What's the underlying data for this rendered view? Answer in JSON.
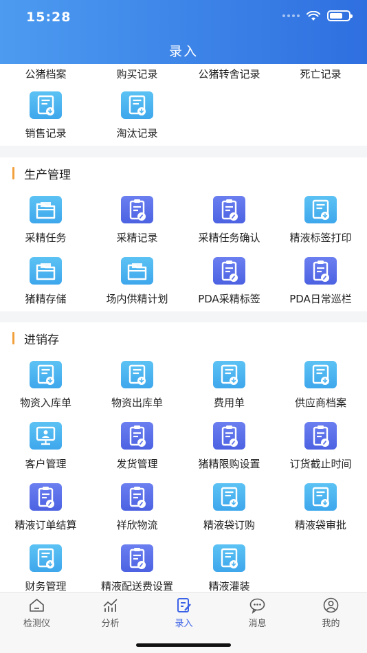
{
  "status": {
    "time": "15:28"
  },
  "header": {
    "title": "录入"
  },
  "top_section": {
    "labels_row": [
      "公猪档案",
      "购买记录",
      "公猪转舍记录",
      "死亡记录"
    ],
    "items": [
      {
        "label": "销售记录",
        "icon": "doc-download-icon",
        "tone": "light"
      },
      {
        "label": "淘汰记录",
        "icon": "doc-download-icon",
        "tone": "light"
      }
    ]
  },
  "production": {
    "title": "生产管理",
    "items": [
      {
        "label": "采精任务",
        "icon": "folder-icon",
        "tone": "light"
      },
      {
        "label": "采精记录",
        "icon": "clipboard-edit-icon",
        "tone": "dark"
      },
      {
        "label": "采精任务确认",
        "icon": "clipboard-edit-icon",
        "tone": "dark"
      },
      {
        "label": "精液标签打印",
        "icon": "doc-download-icon",
        "tone": "light"
      },
      {
        "label": "猪精存储",
        "icon": "folder-icon",
        "tone": "light"
      },
      {
        "label": "场内供精计划",
        "icon": "folder-icon",
        "tone": "light"
      },
      {
        "label": "PDA采精标签",
        "icon": "clipboard-edit-icon",
        "tone": "dark"
      },
      {
        "label": "PDA日常巡栏",
        "icon": "clipboard-edit-icon",
        "tone": "dark"
      }
    ]
  },
  "inventory": {
    "title": "进销存",
    "items": [
      {
        "label": "物资入库单",
        "icon": "doc-download-icon",
        "tone": "light"
      },
      {
        "label": "物资出库单",
        "icon": "doc-download-icon",
        "tone": "light"
      },
      {
        "label": "费用单",
        "icon": "doc-download-icon",
        "tone": "light"
      },
      {
        "label": "供应商档案",
        "icon": "doc-download-icon",
        "tone": "light"
      },
      {
        "label": "客户管理",
        "icon": "monitor-user-icon",
        "tone": "light"
      },
      {
        "label": "发货管理",
        "icon": "clipboard-edit-icon",
        "tone": "dark"
      },
      {
        "label": "猪精限购设置",
        "icon": "clipboard-edit-icon",
        "tone": "dark"
      },
      {
        "label": "订货截止时间",
        "icon": "clipboard-edit-icon",
        "tone": "dark"
      },
      {
        "label": "精液订单结算",
        "icon": "clipboard-edit-icon",
        "tone": "dark"
      },
      {
        "label": "祥欣物流",
        "icon": "clipboard-edit-icon",
        "tone": "dark"
      },
      {
        "label": "精液袋订购",
        "icon": "doc-download-icon",
        "tone": "light"
      },
      {
        "label": "精液袋审批",
        "icon": "doc-download-icon",
        "tone": "light"
      },
      {
        "label": "财务管理",
        "icon": "doc-download-icon",
        "tone": "light"
      },
      {
        "label": "精液配送费设置",
        "icon": "clipboard-edit-icon",
        "tone": "dark"
      },
      {
        "label": "精液灌装",
        "icon": "doc-download-icon",
        "tone": "light"
      }
    ]
  },
  "tabbar": {
    "tabs": [
      {
        "label": "检测仪",
        "icon": "home-icon"
      },
      {
        "label": "分析",
        "icon": "chart-icon"
      },
      {
        "label": "录入",
        "icon": "edit-icon",
        "active": true
      },
      {
        "label": "消息",
        "icon": "message-icon"
      },
      {
        "label": "我的",
        "icon": "user-icon"
      }
    ]
  },
  "colors": {
    "accent": "#3b62e6",
    "section_bar": "#f2a03b",
    "icon_light": "#4ab2ef",
    "icon_dark": "#5a6fe8"
  }
}
